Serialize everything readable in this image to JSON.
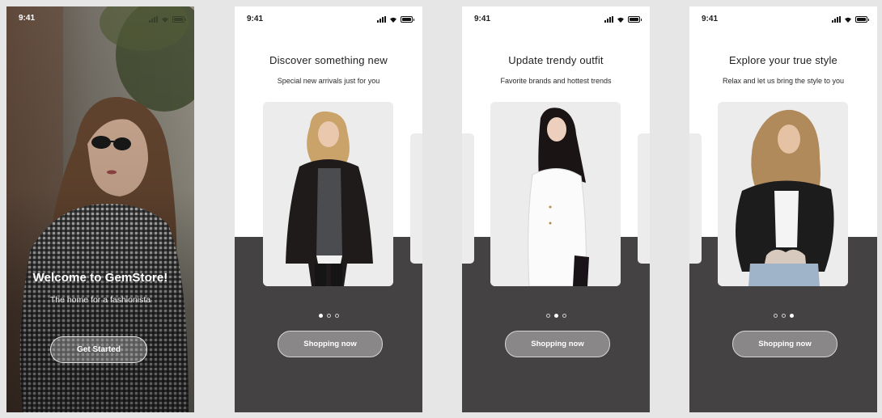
{
  "status_bar": {
    "time": "9:41"
  },
  "welcome": {
    "title": "Welcome to GemStore!",
    "subtitle": "The home for a fashionista",
    "button_label": "Get Started"
  },
  "onboarding": [
    {
      "title": "Discover something new",
      "subtitle": "Special new arrivals just for you",
      "button_label": "Shopping now",
      "active_dot": 1
    },
    {
      "title": "Update trendy outfit",
      "subtitle": "Favorite brands and hottest trends",
      "button_label": "Shopping now",
      "active_dot": 2
    },
    {
      "title": "Explore your true style",
      "subtitle": "Relax and let us bring the style to you",
      "button_label": "Shopping now",
      "active_dot": 3
    }
  ],
  "colors": {
    "dark_panel": "#454244",
    "button_fill": "#8a8789",
    "card_bg": "#ececec",
    "page_bg": "#e6e6e6"
  },
  "icons": [
    "cellular-signal-icon",
    "wifi-icon",
    "battery-icon"
  ]
}
